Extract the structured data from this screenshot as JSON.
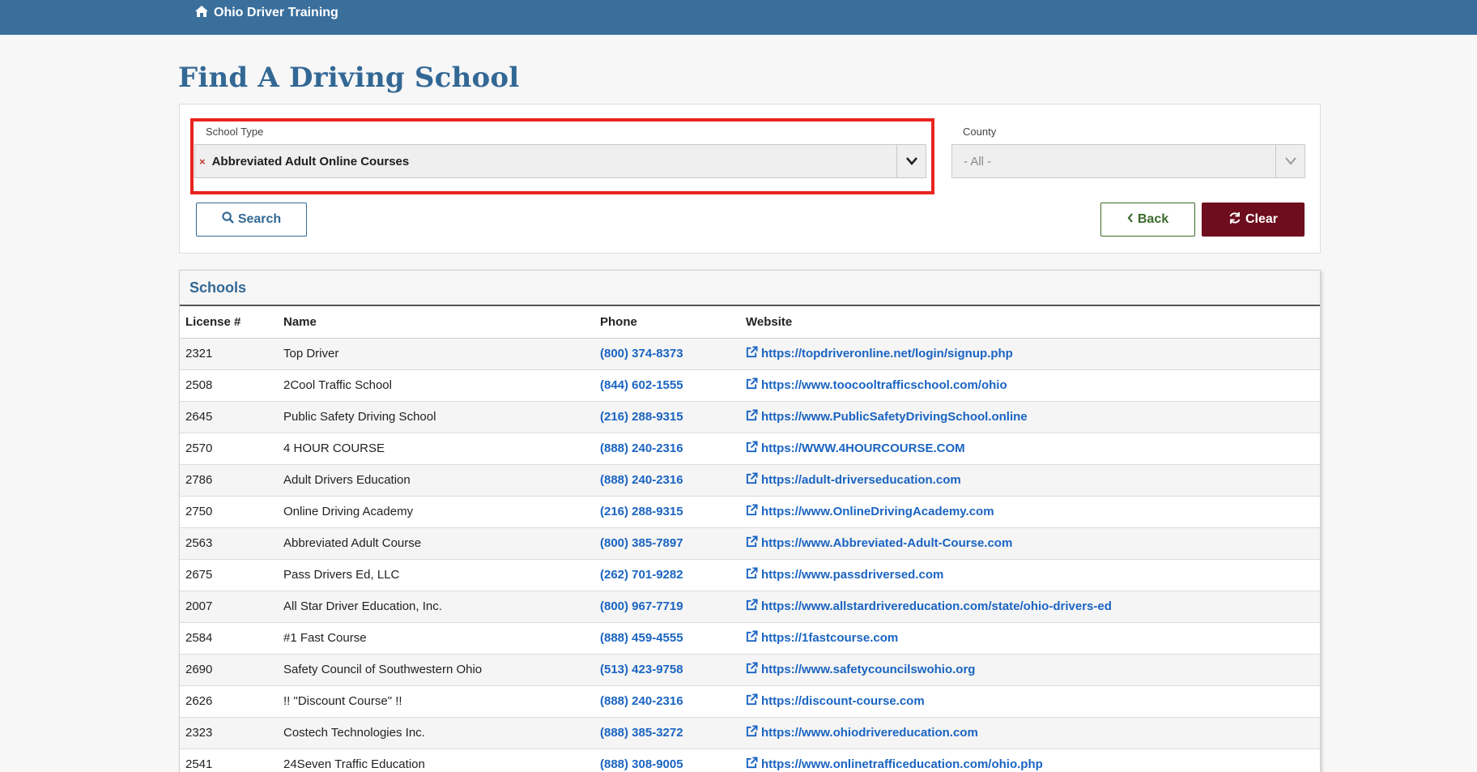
{
  "header": {
    "brand": "Ohio Driver Training",
    "brand_icon": "home-icon"
  },
  "page_title": "Find A Driving School",
  "filters": {
    "school_type_label": "School Type",
    "school_type_value": "Abbreviated Adult Online Courses",
    "county_label": "County",
    "county_value": "- All -"
  },
  "buttons": {
    "search": "Search",
    "back": "Back",
    "clear": "Clear"
  },
  "schools": {
    "title": "Schools",
    "columns": [
      "License #",
      "Name",
      "Phone",
      "Website"
    ],
    "rows": [
      {
        "license": "2321",
        "name": "Top Driver",
        "phone": "(800) 374-8373",
        "website": "https://topdriveronline.net/login/signup.php"
      },
      {
        "license": "2508",
        "name": "2Cool Traffic School",
        "phone": "(844) 602-1555",
        "website": "https://www.toocooltrafficschool.com/ohio"
      },
      {
        "license": "2645",
        "name": "Public Safety Driving School",
        "phone": "(216) 288-9315",
        "website": "https://www.PublicSafetyDrivingSchool.online"
      },
      {
        "license": "2570",
        "name": "4 HOUR COURSE",
        "phone": "(888) 240-2316",
        "website": "https://WWW.4HOURCOURSE.COM"
      },
      {
        "license": "2786",
        "name": "Adult Drivers Education",
        "phone": "(888) 240-2316",
        "website": "https://adult-driverseducation.com"
      },
      {
        "license": "2750",
        "name": "Online Driving Academy",
        "phone": "(216) 288-9315",
        "website": "https://www.OnlineDrivingAcademy.com"
      },
      {
        "license": "2563",
        "name": "Abbreviated Adult Course",
        "phone": "(800) 385-7897",
        "website": "https://www.Abbreviated-Adult-Course.com"
      },
      {
        "license": "2675",
        "name": "Pass Drivers Ed, LLC",
        "phone": "(262) 701-9282",
        "website": "https://www.passdriversed.com"
      },
      {
        "license": "2007",
        "name": "All Star Driver Education, Inc.",
        "phone": "(800) 967-7719",
        "website": "https://www.allstardrivereducation.com/state/ohio-drivers-ed"
      },
      {
        "license": "2584",
        "name": "#1 Fast Course",
        "phone": "(888) 459-4555",
        "website": "https://1fastcourse.com"
      },
      {
        "license": "2690",
        "name": "Safety Council of Southwestern Ohio",
        "phone": "(513) 423-9758",
        "website": "https://www.safetycouncilswohio.org"
      },
      {
        "license": "2626",
        "name": "!! \"Discount Course\" !!",
        "phone": "(888) 240-2316",
        "website": "https://discount-course.com"
      },
      {
        "license": "2323",
        "name": "Costech Technologies Inc.",
        "phone": "(888) 385-3272",
        "website": "https://www.ohiodrivereducation.com"
      },
      {
        "license": "2541",
        "name": "24Seven Traffic Education",
        "phone": "(888) 308-9005",
        "website": "https://www.onlinetrafficeducation.com/ohio.php"
      }
    ]
  },
  "colors": {
    "topbar": "#3a6f9c",
    "title": "#336895",
    "link": "#1a64c2",
    "clear_button": "#6e0d1d",
    "back_button": "#3a6a2a",
    "highlight": "#e8241f"
  }
}
